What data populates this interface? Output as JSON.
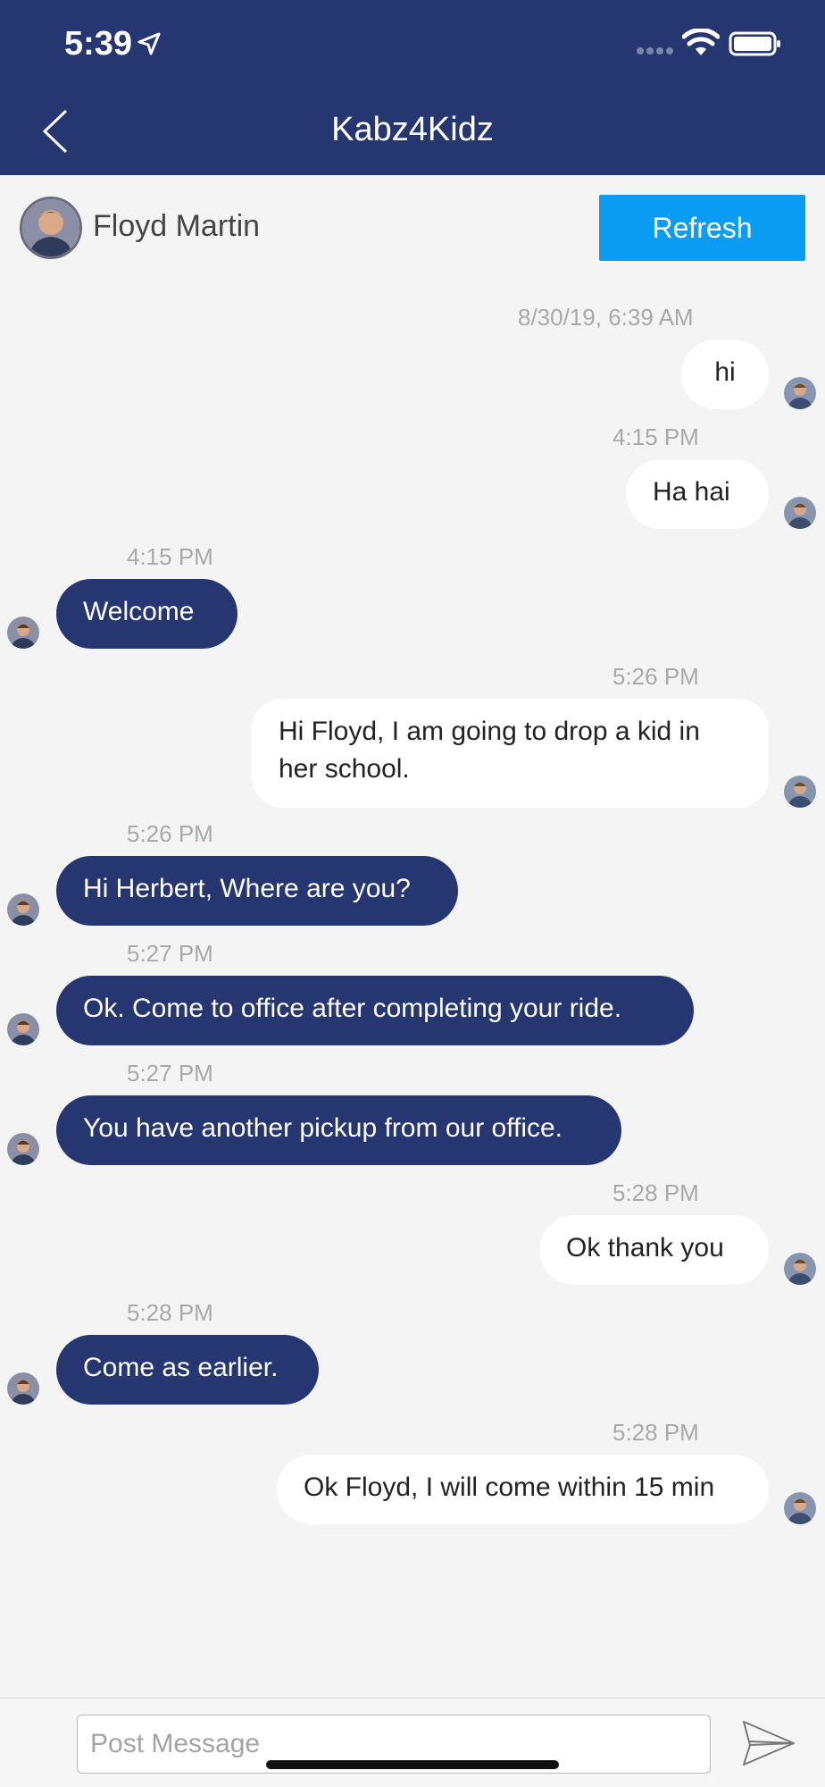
{
  "status_bar": {
    "time": "5:39"
  },
  "nav": {
    "title": "Kabz4Kidz"
  },
  "contact": {
    "name": "Floyd Martin",
    "refresh_label": "Refresh"
  },
  "messages": [
    {
      "time": "8/30/19, 6:39 AM",
      "text": "hi",
      "direction": "outgoing"
    },
    {
      "time": "4:15 PM",
      "text": "Ha hai",
      "direction": "outgoing"
    },
    {
      "time": "4:15 PM",
      "text": "Welcome",
      "direction": "incoming"
    },
    {
      "time": "5:26 PM",
      "text": "Hi Floyd, I am going to drop a kid in her school.",
      "direction": "outgoing"
    },
    {
      "time": "5:26 PM",
      "text": "Hi Herbert, Where are you?",
      "direction": "incoming"
    },
    {
      "time": "5:27 PM",
      "text": "Ok. Come to office after completing your ride.",
      "direction": "incoming"
    },
    {
      "time": "5:27 PM",
      "text": "You have another pickup from our office.",
      "direction": "incoming"
    },
    {
      "time": "5:28 PM",
      "text": "Ok thank you",
      "direction": "outgoing"
    },
    {
      "time": "5:28 PM",
      "text": "Come as earlier.",
      "direction": "incoming"
    },
    {
      "time": "5:28 PM",
      "text": "Ok Floyd, I will come within 15 min",
      "direction": "outgoing"
    }
  ],
  "composer": {
    "placeholder": "Post Message"
  },
  "colors": {
    "brand_navy": "#263670",
    "refresh_blue": "#0a9df2",
    "background": "#f4f4f4"
  },
  "icons": {
    "back": "chevron-left-icon",
    "send": "paper-plane-icon",
    "location": "location-arrow-icon",
    "wifi": "wifi-icon",
    "battery": "battery-icon"
  }
}
